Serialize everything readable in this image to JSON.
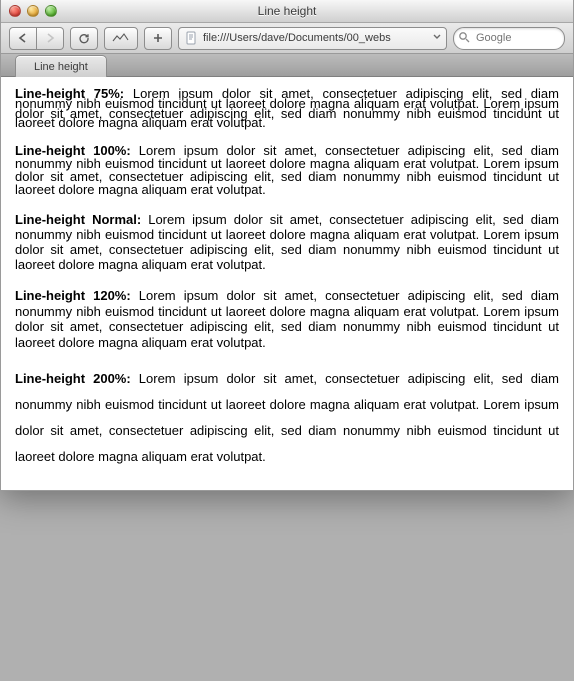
{
  "window": {
    "title": "Line height"
  },
  "toolbar": {
    "address": "file:///Users/dave/Documents/00_webs",
    "search_placeholder": "Google"
  },
  "tab": {
    "title": "Line height"
  },
  "paragraphs": [
    {
      "id": "p75",
      "label": "Line-height 75%:",
      "body": "Lorem ipsum dolor sit amet, consectetuer adipiscing elit, sed diam nonummy nibh euismod tincidunt ut laoreet dolore magna aliquam erat volutpat. Lorem ipsum dolor sit amet, consectetuer adipiscing elit, sed diam nonummy nibh euismod tincidunt ut laoreet dolore magna aliquam erat volutpat."
    },
    {
      "id": "p100",
      "label": "Line-height 100%:",
      "body": "Lorem ipsum dolor sit amet, consectetuer adipiscing elit, sed diam nonummy nibh euismod tincidunt ut laoreet dolore magna aliquam erat volutpat. Lorem ipsum dolor sit amet, consectetuer adipiscing elit, sed diam nonummy nibh euismod tincidunt ut laoreet dolore magna aliquam erat volutpat."
    },
    {
      "id": "pnorm",
      "label": "Line-height Normal:",
      "body": "Lorem ipsum dolor sit amet, consectetuer adipiscing elit, sed diam nonummy nibh euismod tincidunt ut laoreet dolore magna aliquam erat volutpat. Lorem ipsum dolor sit amet, consectetuer adipiscing elit, sed diam nonummy nibh euismod tincidunt ut laoreet dolore magna aliquam erat volutpat."
    },
    {
      "id": "p120",
      "label": "Line-height 120%:",
      "body": "Lorem ipsum dolor sit amet, consectetuer adipiscing elit, sed diam nonummy nibh euismod tincidunt ut laoreet dolore magna aliquam erat volutpat. Lorem ipsum dolor sit amet, consectetuer adipiscing elit, sed diam nonummy nibh euismod tincidunt ut laoreet dolore magna aliquam erat volutpat."
    },
    {
      "id": "p200",
      "label": "Line-height 200%:",
      "body": "Lorem ipsum dolor sit amet, consectetuer adipiscing elit, sed diam nonummy nibh euismod tincidunt ut laoreet dolore magna aliquam erat volutpat. Lorem ipsum dolor sit amet, consectetuer adipiscing elit, sed diam nonummy nibh euismod tincidunt ut laoreet dolore magna aliquam erat volutpat."
    }
  ]
}
